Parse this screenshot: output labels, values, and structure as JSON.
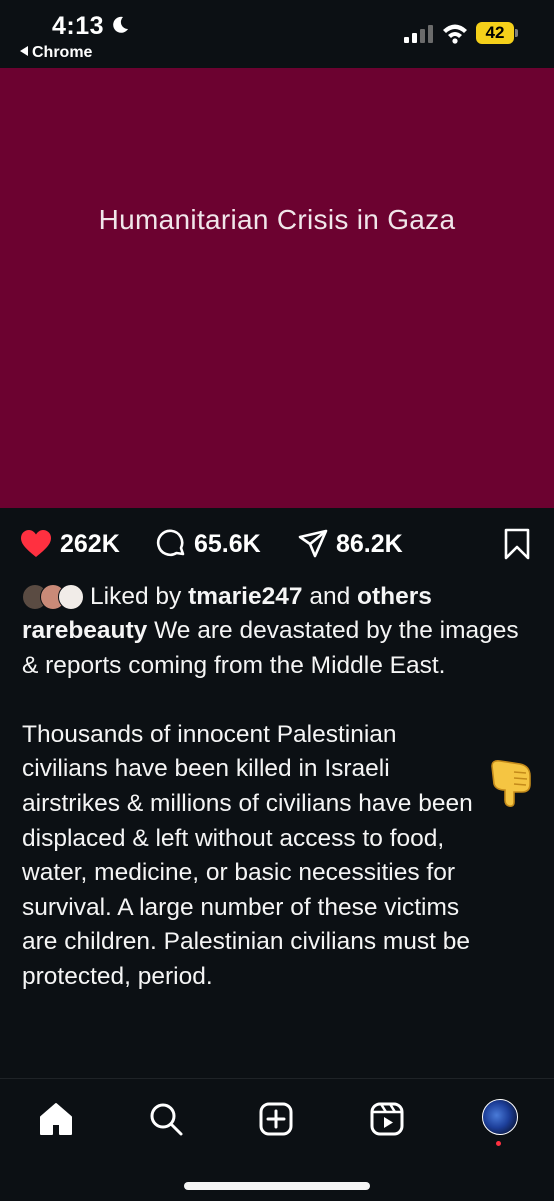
{
  "status_bar": {
    "time": "4:13",
    "back_app": "Chrome",
    "battery": "42"
  },
  "post": {
    "image_title": "Humanitarian Crisis in Gaza",
    "image_background": "#6c0230"
  },
  "actions": {
    "likes": "262K",
    "comments": "65.6K",
    "shares": "86.2K",
    "like_color": "#ff3040"
  },
  "liked_by": {
    "prefix": "Liked by",
    "user": "tmarie247",
    "conjunction": "and",
    "others": "others"
  },
  "caption": {
    "username": "rarebeauty",
    "paragraph1": "We are devastated by the images & reports coming from the Middle East.",
    "paragraph2": "Thousands of innocent Palestinian civilians have been killed in Israeli airstrikes & millions of civilians have been displaced & left without access to food, water, medicine, or basic necessities for survival. A large number of these victims are children. Palestinian civilians must be protected, period.",
    "emoji": "backhand-index-pointing-down-icon"
  },
  "nav": {
    "items": [
      "home-icon",
      "search-icon",
      "create-icon",
      "reels-icon",
      "profile-avatar"
    ]
  }
}
